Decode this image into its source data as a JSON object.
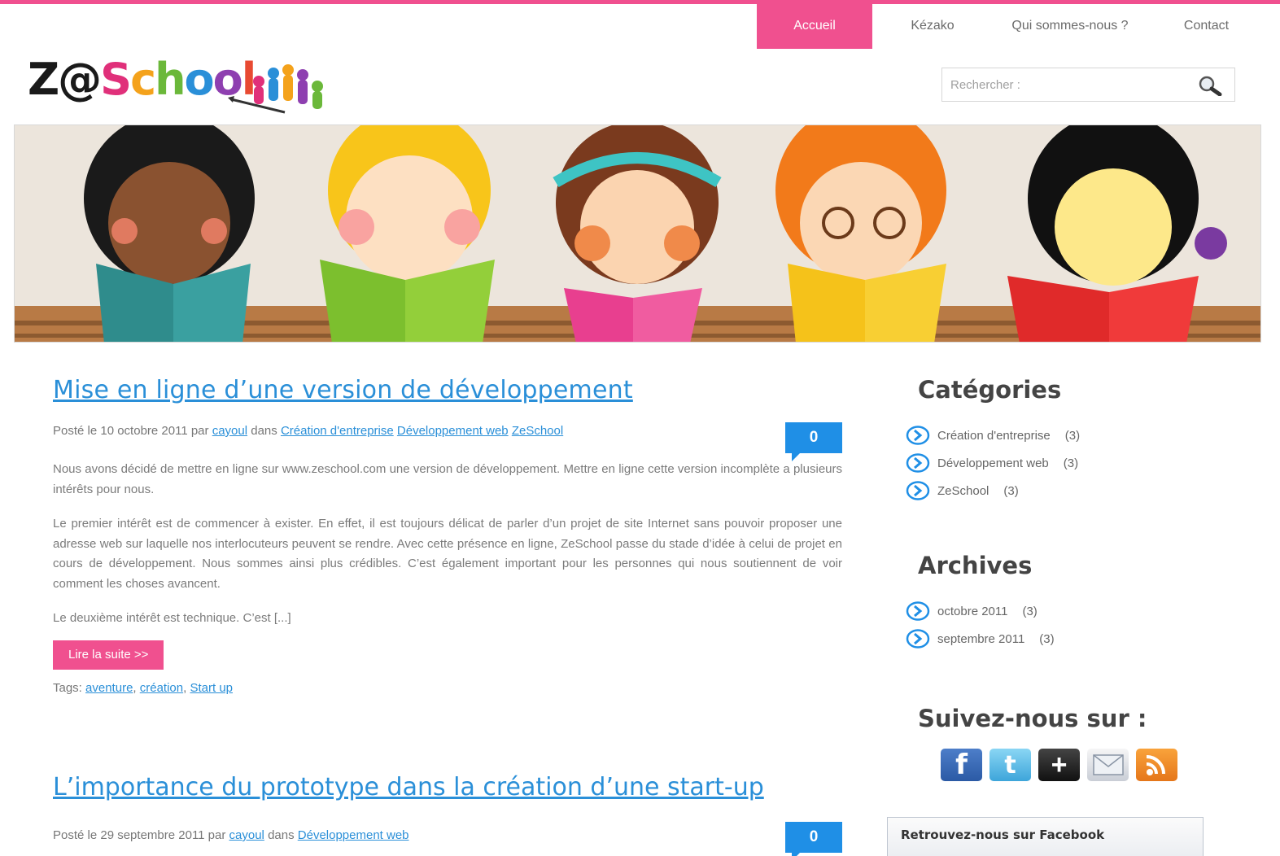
{
  "nav": {
    "items": [
      {
        "label": "Accueil",
        "active": true
      },
      {
        "label": "Kézako"
      },
      {
        "label": "Qui sommes-nous ?"
      },
      {
        "label": "Contact"
      }
    ]
  },
  "logo": {
    "text": "Z@School"
  },
  "search": {
    "placeholder": "Rechercher :"
  },
  "posts": [
    {
      "title": "Mise en ligne d’une version de développement",
      "meta_prefix": "Posté le 10 octobre 2011 par",
      "author": "cayoul",
      "meta_in": "dans",
      "categories": [
        "Création d'entreprise",
        "Développement web",
        "ZeSchool"
      ],
      "comments": "0",
      "paragraphs": [
        "Nous avons décidé de mettre en ligne sur www.zeschool.com une version de développement. Mettre en ligne cette version incomplète a plusieurs intérêts pour nous.",
        "Le premier intérêt est de commencer à exister. En effet, il est toujours délicat de parler d’un projet de site Internet sans pouvoir proposer une adresse web sur laquelle nos interlocuteurs peuvent se rendre. Avec cette présence en ligne, ZeSchool passe du stade d’idée à celui de projet en cours de développement. Nous sommes ainsi plus crédibles. C’est également important pour les personnes qui nous soutiennent de voir comment les choses avancent.",
        "Le deuxième intérêt est technique. C’est [...]"
      ],
      "read_more": "Lire la suite >>",
      "tags_label": "Tags:",
      "tags": [
        "aventure",
        "création",
        "Start up"
      ]
    },
    {
      "title": "L’importance du prototype dans la création d’une start-up",
      "meta_prefix": "Posté le 29 septembre 2011 par",
      "author": "cayoul",
      "meta_in": "dans",
      "categories": [
        "Développement web"
      ],
      "comments": "0"
    }
  ],
  "sidebar": {
    "categories_title": "Catégories",
    "categories": [
      {
        "label": "Création d'entreprise",
        "count": "(3)"
      },
      {
        "label": "Développement web",
        "count": "(3)"
      },
      {
        "label": "ZeSchool",
        "count": "(3)"
      }
    ],
    "archives_title": "Archives",
    "archives": [
      {
        "label": "octobre 2011",
        "count": "(3)"
      },
      {
        "label": "septembre 2011",
        "count": "(3)"
      }
    ],
    "follow_title": "Suivez-nous sur :",
    "social": [
      "facebook-icon",
      "twitter-icon",
      "google-plus-icon",
      "mail-icon",
      "rss-icon"
    ],
    "facebook_box_title": "Retrouvez-nous sur Facebook"
  },
  "colors": {
    "accent_pink": "#f0508f",
    "link_blue": "#2a8fd8",
    "badge_blue": "#1f8fe6"
  }
}
